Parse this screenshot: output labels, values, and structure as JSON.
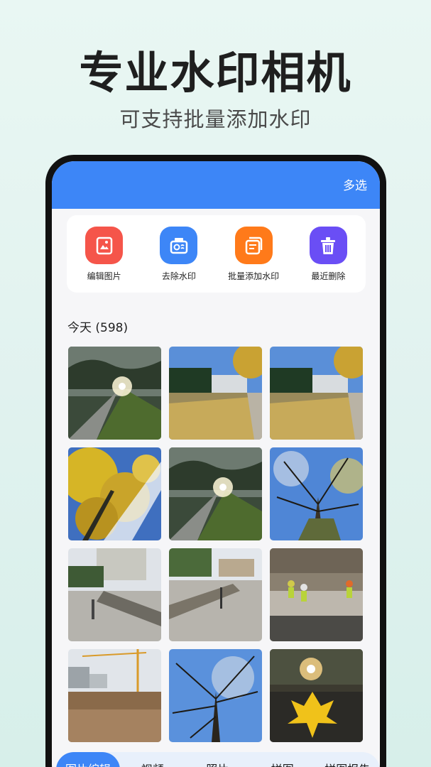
{
  "promo": {
    "title": "专业水印相机",
    "subtitle": "可支持批量添加水印"
  },
  "appbar": {
    "action_label": "多选",
    "color": "#3d86f7"
  },
  "tools": [
    {
      "label": "编辑图片",
      "icon": "image-edit-icon",
      "color": "#f5554a"
    },
    {
      "label": "去除水印",
      "icon": "remove-watermark-icon",
      "color": "#3d86f7"
    },
    {
      "label": "批量添加水印",
      "icon": "batch-watermark-icon",
      "color": "#ff7a1a"
    },
    {
      "label": "最近删除",
      "icon": "trash-icon",
      "color": "#6a4ef5"
    }
  ],
  "gallery": {
    "section_title": "今天 (598)",
    "photos": [
      {
        "name": "photo-sunset-path"
      },
      {
        "name": "photo-leaf-road"
      },
      {
        "name": "photo-leaf-road-2"
      },
      {
        "name": "photo-ginkgo-tree"
      },
      {
        "name": "photo-sunset-path-2"
      },
      {
        "name": "photo-tree-sky"
      },
      {
        "name": "photo-street-construction"
      },
      {
        "name": "photo-street-construction-2"
      },
      {
        "name": "photo-workers-site"
      },
      {
        "name": "photo-crane-site"
      },
      {
        "name": "photo-branches-sky"
      },
      {
        "name": "photo-sun-leaf"
      }
    ]
  },
  "tabs": [
    {
      "label": "图片编辑",
      "active": true
    },
    {
      "label": "视频",
      "active": false
    },
    {
      "label": "照片",
      "active": false
    },
    {
      "label": "拼图",
      "active": false
    },
    {
      "label": "拼图报告",
      "active": false
    }
  ]
}
